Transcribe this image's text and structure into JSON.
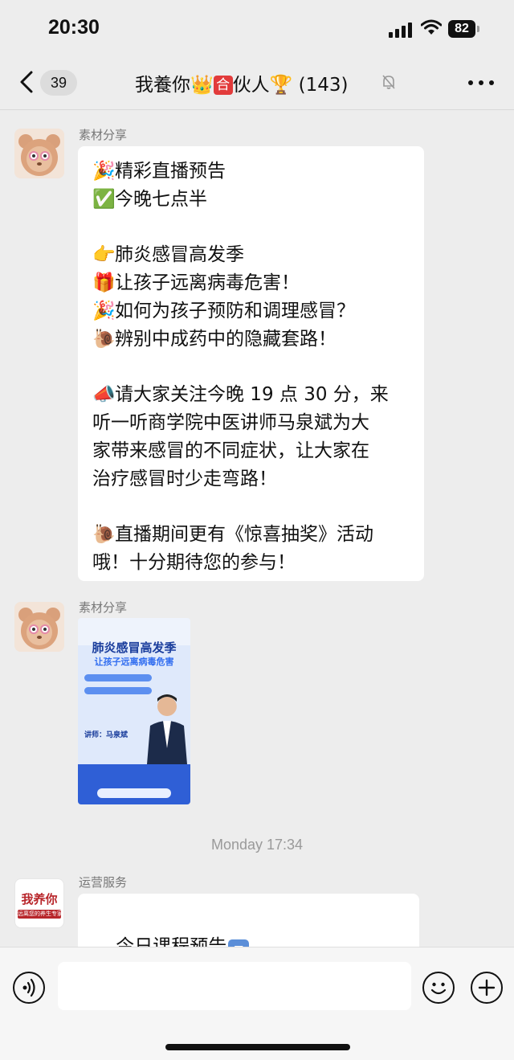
{
  "status_bar": {
    "time": "20:30",
    "battery": "82"
  },
  "nav": {
    "unread_count": "39",
    "title_part1": "我養你",
    "title_part2": "伙人",
    "member_count": "(143)"
  },
  "messages": [
    {
      "sender": "素材分享",
      "lines": [
        {
          "emoji": "🎉",
          "text": "精彩直播预告"
        },
        {
          "emoji": "✅",
          "text": "今晚七点半"
        },
        {
          "emoji": "",
          "text": ""
        },
        {
          "emoji": "👉",
          "text": "肺炎感冒高发季"
        },
        {
          "emoji": "🎁",
          "text": "让孩子远离病毒危害！"
        },
        {
          "emoji": "🎉",
          "text": "如何为孩子预防和调理感冒？"
        },
        {
          "emoji": "🐌",
          "text": "辨别中成药中的隐藏套路！"
        },
        {
          "emoji": "",
          "text": ""
        },
        {
          "emoji": "📣",
          "text": "请大家关注今晚 19 点 30 分，来"
        },
        {
          "emoji": "",
          "text": "听一听商学院中医讲师马泉斌为大"
        },
        {
          "emoji": "",
          "text": "家带来感冒的不同症状，让大家在"
        },
        {
          "emoji": "",
          "text": "治疗感冒时少走弯路！"
        },
        {
          "emoji": "",
          "text": ""
        },
        {
          "emoji": "🐌",
          "text": "直播期间更有《惊喜抽奖》活动"
        },
        {
          "emoji": "",
          "text": "哦！十分期待您的参与！"
        }
      ]
    },
    {
      "sender": "素材分享",
      "poster": {
        "headline": "肺炎感冒高发季",
        "subline": "让孩子远离病毒危害",
        "speaker": "讲师：马泉斌"
      }
    },
    {
      "timestamp": "Monday 17:34"
    },
    {
      "sender": "运营服务",
      "avatar_text": "我养你",
      "avatar_subtext": "远离您的养生专家",
      "text": "今日课程预告",
      "emoji": "🔽"
    }
  ],
  "input": {
    "placeholder": ""
  }
}
